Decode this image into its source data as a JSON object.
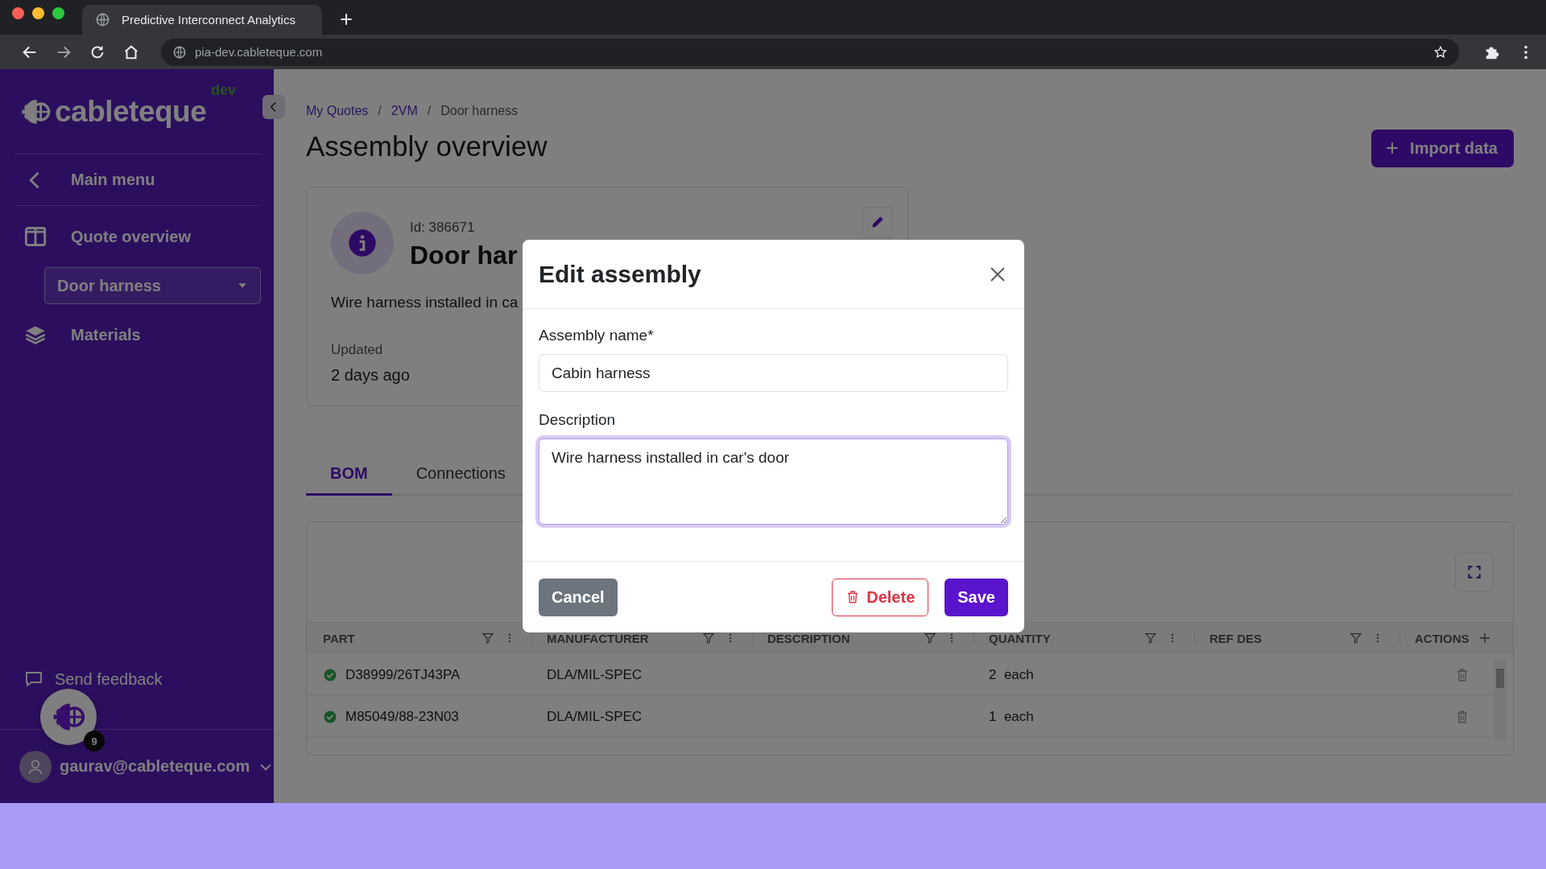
{
  "browser": {
    "tab_title": "Predictive Interconnect Analytics",
    "url": "pia-dev.cableteque.com"
  },
  "sidebar": {
    "logo_text": "cableteque",
    "env_badge": "dev",
    "back_item": "Main menu",
    "items": [
      {
        "kind": "nav",
        "label": "Quote overview"
      },
      {
        "kind": "select",
        "value": "Door harness"
      },
      {
        "kind": "nav",
        "label": "Materials"
      }
    ],
    "feedback": "Send feedback",
    "user": "gaurav@cableteque.com",
    "notification_count": "9"
  },
  "breadcrumbs": [
    {
      "label": "My Quotes",
      "link": true
    },
    {
      "separator": "/"
    },
    {
      "label": "2VM",
      "link": true
    },
    {
      "separator": "/"
    },
    {
      "label": "Door harness",
      "link": false
    }
  ],
  "page_title": "Assembly overview",
  "import_button": "Import data",
  "assembly_card": {
    "id": "Id: 386671",
    "name": "Door har",
    "description": "Wire harness installed in ca",
    "updated_label": "Updated",
    "updated_value": "2 days ago"
  },
  "tabs": [
    {
      "label": "BOM",
      "selected": true
    },
    {
      "label": "Connections",
      "selected": false
    }
  ],
  "table": {
    "columns": [
      {
        "label": "PART",
        "filter": true
      },
      {
        "label": "MANUFACTURER",
        "filter": true
      },
      {
        "label": "DESCRIPTION",
        "filter": true
      },
      {
        "label": "QUANTITY",
        "filter": true
      },
      {
        "label": "REF DES",
        "filter": true
      },
      {
        "label": "ACTIONS",
        "filter": false
      }
    ],
    "rows": [
      {
        "verified": true,
        "part": "D38999/26TJ43PA",
        "manufacturer": "DLA/MIL-SPEC",
        "quantity": "2  each"
      },
      {
        "verified": true,
        "part": "M85049/88-23N03",
        "manufacturer": "DLA/MIL-SPEC",
        "quantity": "1  each"
      }
    ]
  },
  "modal": {
    "title": "Edit assembly",
    "fields": [
      {
        "kind": "input",
        "label": "Assembly name*",
        "value": "Cabin harness",
        "focused": false
      },
      {
        "kind": "textarea",
        "label": "Description",
        "value": "Wire harness installed in car's door",
        "focused": true
      }
    ],
    "buttons": [
      {
        "kind": "secondary",
        "label": "Cancel"
      },
      {
        "kind": "danger",
        "label": "Delete"
      },
      {
        "kind": "primary",
        "label": "Save"
      }
    ]
  }
}
